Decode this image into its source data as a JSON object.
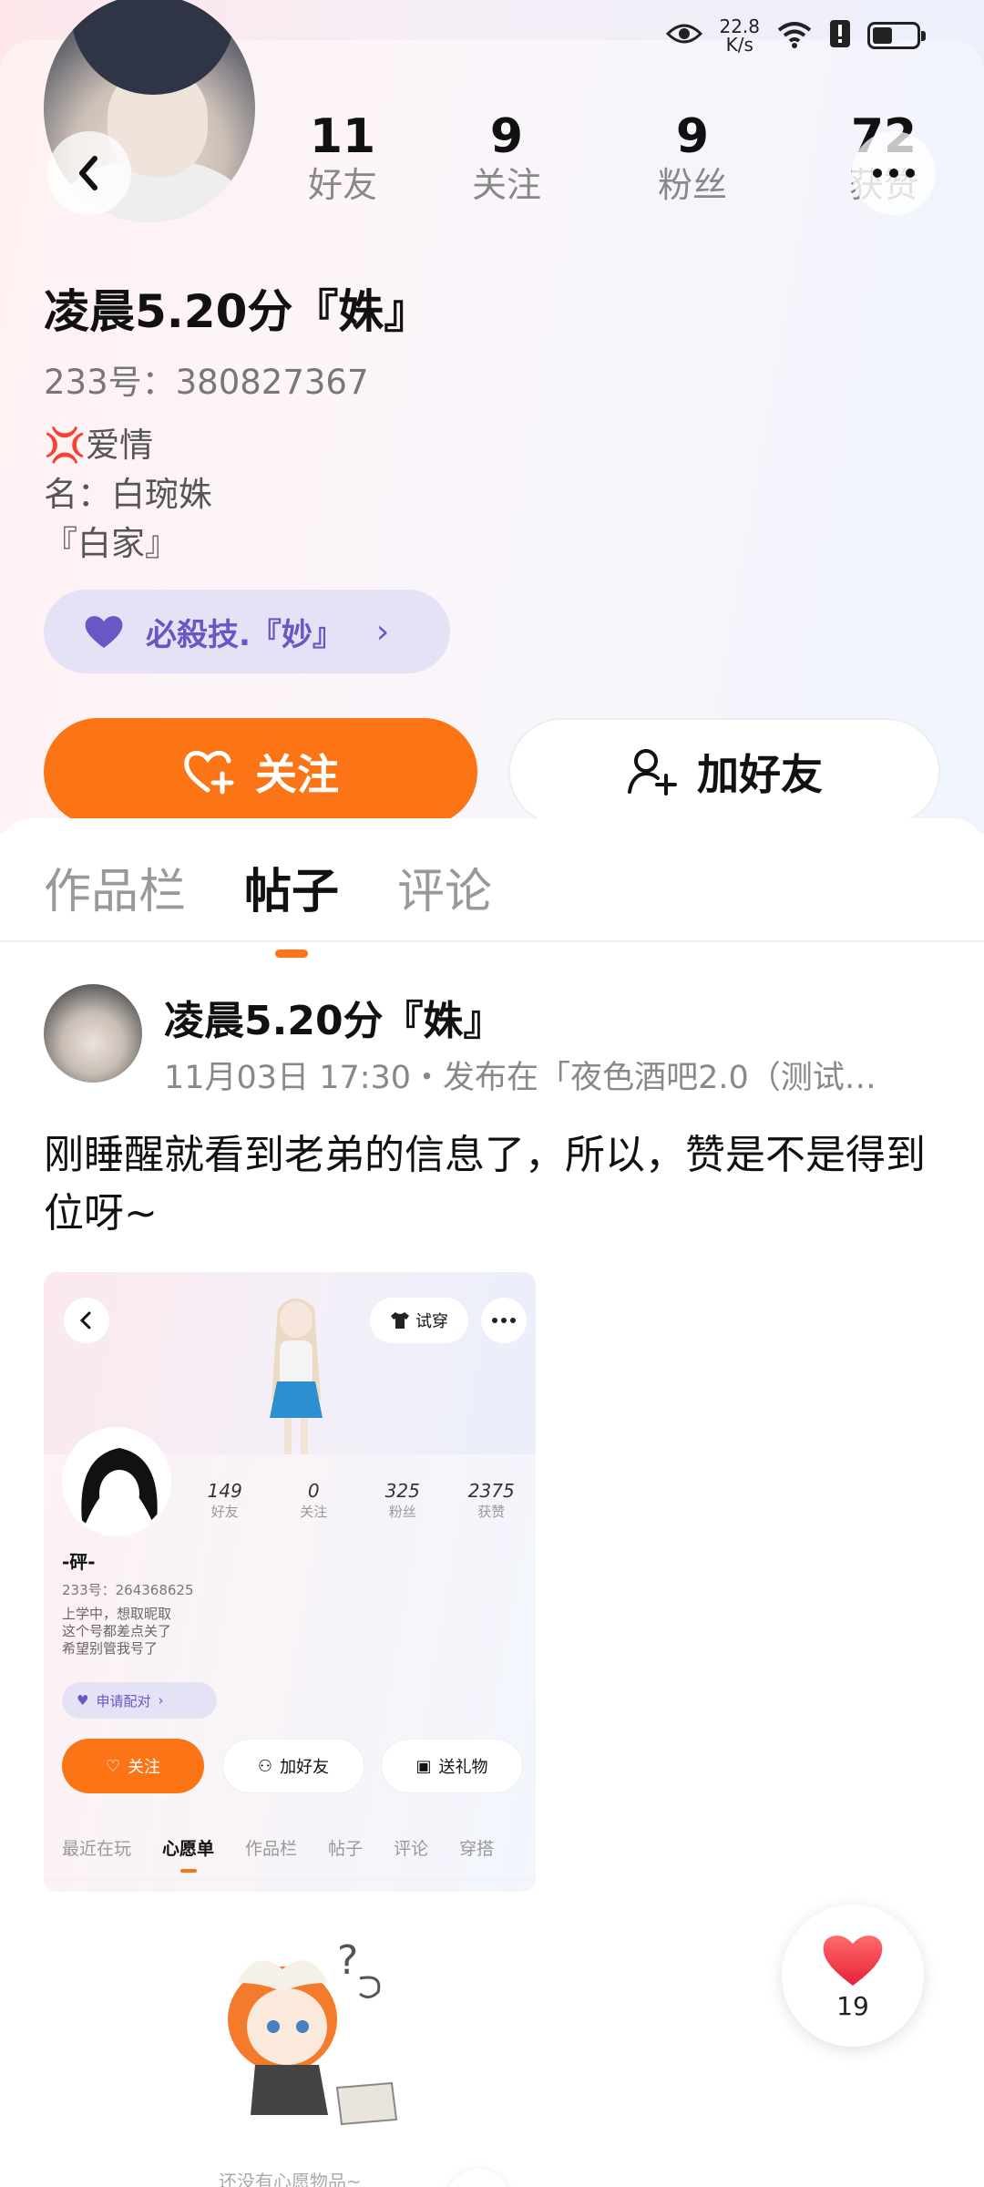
{
  "status_bar": {
    "net_speed_value": "22.8",
    "net_speed_unit": "K/s",
    "battery_level": 0.45
  },
  "profile": {
    "username": "凌晨5.20分『姝』",
    "uid": "233号：380827367",
    "bio": "💢爱情\n名：白琬姝\n『白家』",
    "skill_label": "必殺技.『妙』",
    "stats": [
      {
        "num": "11",
        "label": "好友"
      },
      {
        "num": "9",
        "label": "关注"
      },
      {
        "num": "9",
        "label": "粉丝"
      },
      {
        "num": "72",
        "label": "获赞"
      }
    ],
    "follow_label": "关注",
    "add_friend_label": "加好友"
  },
  "tabs": [
    "作品栏",
    "帖子",
    "评论"
  ],
  "post": {
    "author": "凌晨5.20分『姝』",
    "meta": "11月03日 17:30・发布在「夜色酒吧2.0（测试…",
    "text": "刚睡醒就看到老弟的信息了，所以，赞是不是得到位呀~",
    "screenshot": {
      "try_on_label": "试穿",
      "stats": [
        {
          "num": "149",
          "label": "好友"
        },
        {
          "num": "0",
          "label": "关注"
        },
        {
          "num": "325",
          "label": "粉丝"
        },
        {
          "num": "2375",
          "label": "获赞"
        }
      ],
      "name": "-砰-",
      "uid": "233号：264368625",
      "bio": "上学中，想取昵取\n这个号都差点关了\n希望别管我号了",
      "pill": "申请配对",
      "follow": "关注",
      "add_friend": "加好友",
      "gift": "送礼物",
      "tabs": [
        "最近在玩",
        "心愿单",
        "作品栏",
        "帖子",
        "评论",
        "穿搭"
      ],
      "empty_text": "还没有心愿物品~"
    }
  },
  "like": {
    "count": "19"
  },
  "colors": {
    "accent": "#fb7416",
    "purple": "#6a56c4",
    "pill_bg": "#e6e2f6"
  }
}
